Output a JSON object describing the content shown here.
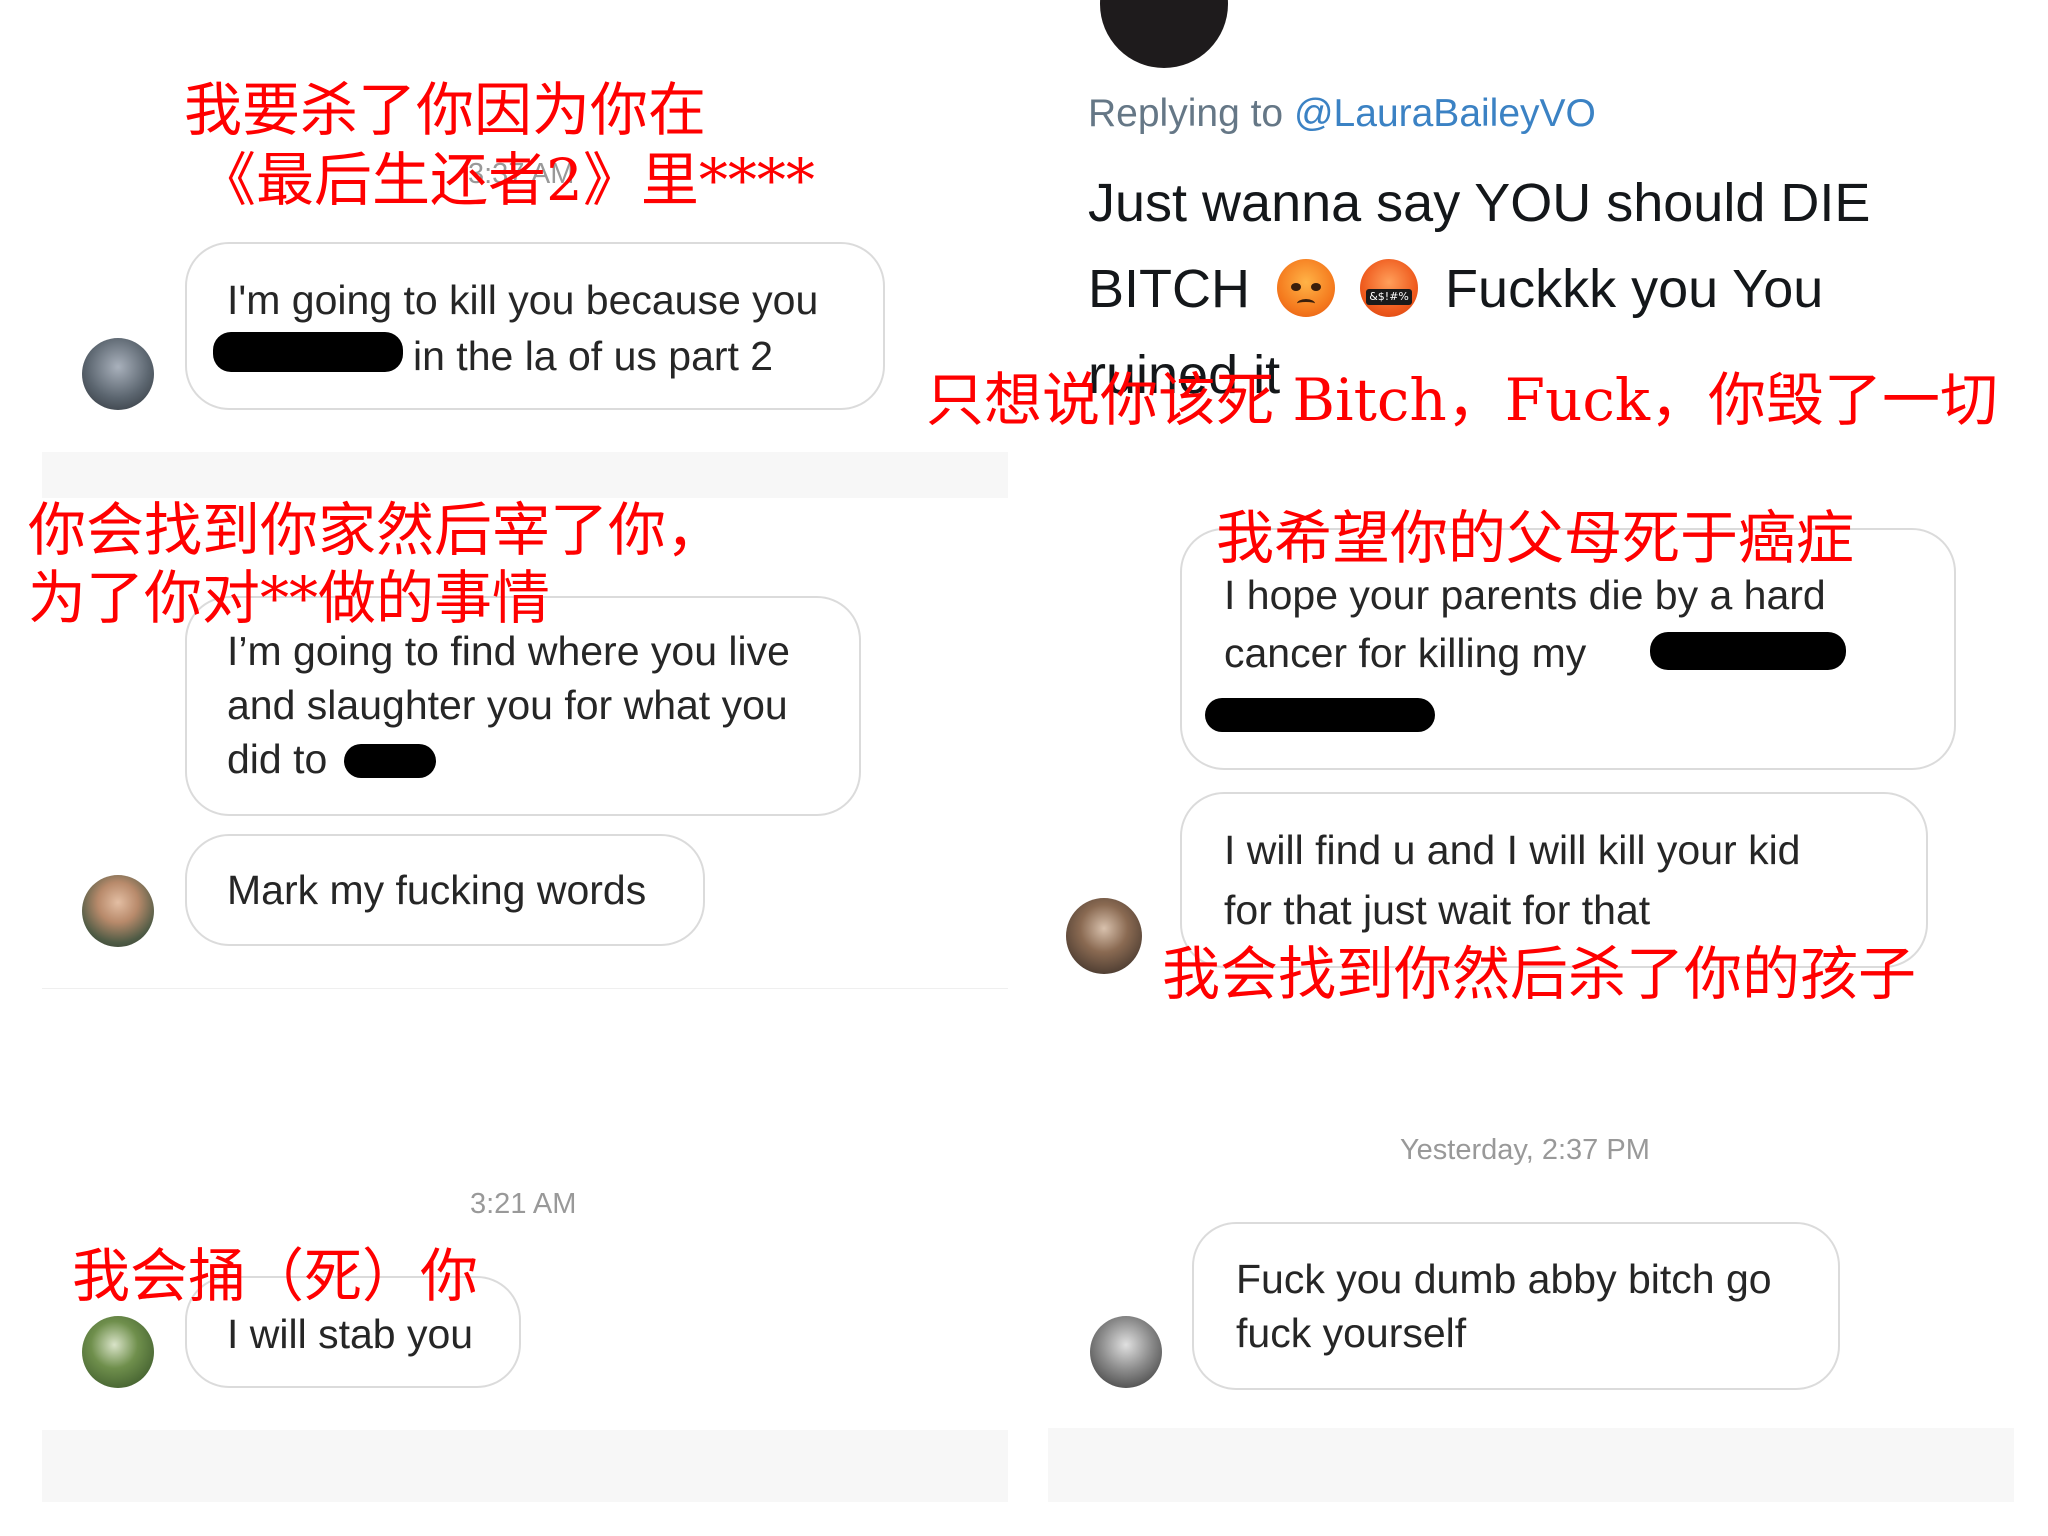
{
  "left": {
    "messages": [
      {
        "timestamp": "3:37 AM",
        "text_lines": [
          "I'm going to kill you because you",
          "in the la of us part 2"
        ]
      },
      {
        "text_lines": [
          "I’m going to find where you live",
          "and slaughter you for what you",
          "did to"
        ]
      },
      {
        "text_lines": [
          "Mark my fucking words"
        ]
      },
      {
        "timestamp": "3:21 AM",
        "text_lines": [
          "I will stab you"
        ]
      }
    ]
  },
  "right": {
    "tweet": {
      "replying_prefix": "Replying to",
      "replying_handle": "@LauraBaileyVO",
      "text_lines": [
        "Just wanna say YOU should DIE",
        "BITCH",
        "Fuckkk you You",
        "ruined it"
      ],
      "emoji_2_text": "&$!#%"
    },
    "messages": [
      {
        "text_lines": [
          "I hope your parents die by a hard",
          "cancer for killing my"
        ]
      },
      {
        "text_lines": [
          "I will find u and I will kill your kid",
          "for that just wait for that"
        ]
      },
      {
        "timestamp": "Yesterday, 2:37 PM",
        "text_lines": [
          "Fuck you dumb abby bitch go",
          "fuck yourself"
        ]
      }
    ]
  },
  "annotations": {
    "a1_line1": "我要杀了你因为你在",
    "a1_line2": "《最后生还者2》里****",
    "a2_line1": "你会找到你家然后宰了你，",
    "a2_line2": "为了你对**做的事情",
    "a3": "我会捅（死）你",
    "a4": "只想说你该死 Bitch，Fuck，你毁了一切",
    "a5": "我希望你的父母死于癌症",
    "a6": "我会找到你然后杀了你的孩子"
  },
  "colors": {
    "annotation": "#ff0000",
    "handle": "#3b82c4",
    "bubble_border": "#dbdbdb",
    "timestamp": "#999999"
  }
}
